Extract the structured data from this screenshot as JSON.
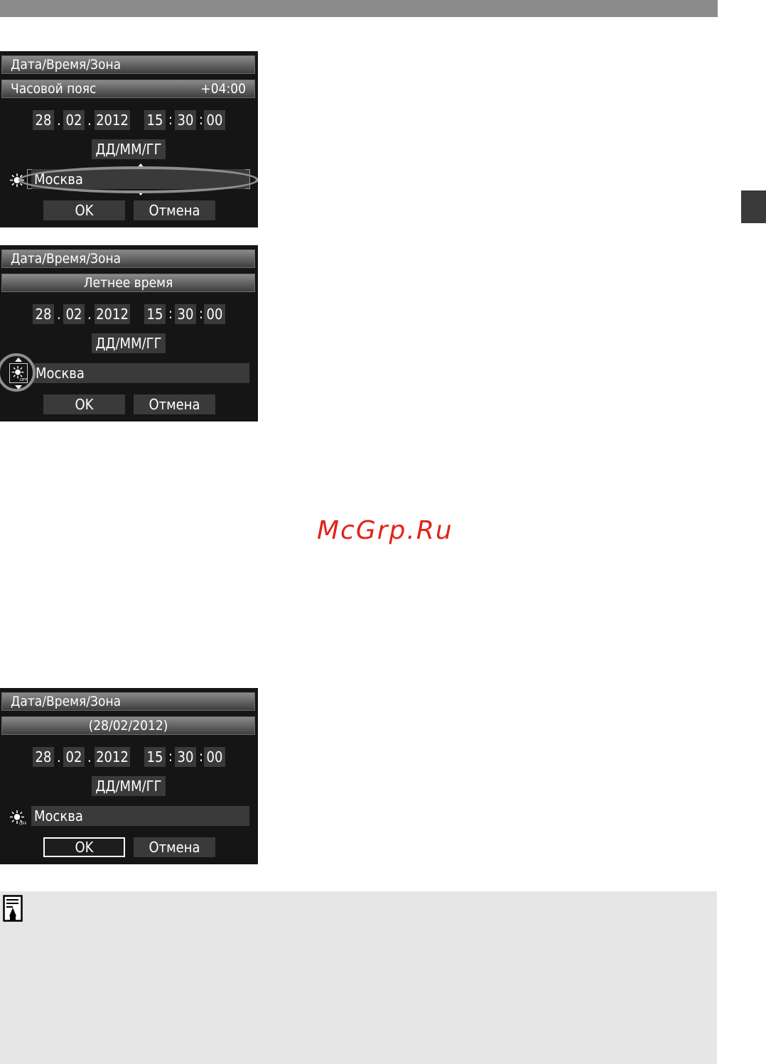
{
  "watermark": "McGrp.Ru",
  "screens": [
    {
      "title": "Дата/Время/Зона",
      "info_label": "Часовой пояс",
      "info_value": "+04:00",
      "date": {
        "day": "28",
        "month": "02",
        "year": "2012"
      },
      "time": {
        "hour": "15",
        "minute": "30",
        "second": "00"
      },
      "format": "ДД/ММ/ГГ",
      "zone": "Москва",
      "ok": "OK",
      "cancel": "Отмена"
    },
    {
      "title": "Дата/Время/Зона",
      "info_label": "Летнее время",
      "date": {
        "day": "28",
        "month": "02",
        "year": "2012"
      },
      "time": {
        "hour": "15",
        "minute": "30",
        "second": "00"
      },
      "format": "ДД/ММ/ГГ",
      "zone": "Москва",
      "ok": "OK",
      "cancel": "Отмена"
    },
    {
      "title": "Дата/Время/Зона",
      "info_label": "(28/02/2012)",
      "date": {
        "day": "28",
        "month": "02",
        "year": "2012"
      },
      "time": {
        "hour": "15",
        "minute": "30",
        "second": "00"
      },
      "format": "ДД/ММ/ГГ",
      "zone": "Москва",
      "ok": "OK",
      "cancel": "Отмена"
    }
  ],
  "icons": {
    "dst": "dst-sun-off-icon",
    "memo": "memo-note-icon"
  }
}
